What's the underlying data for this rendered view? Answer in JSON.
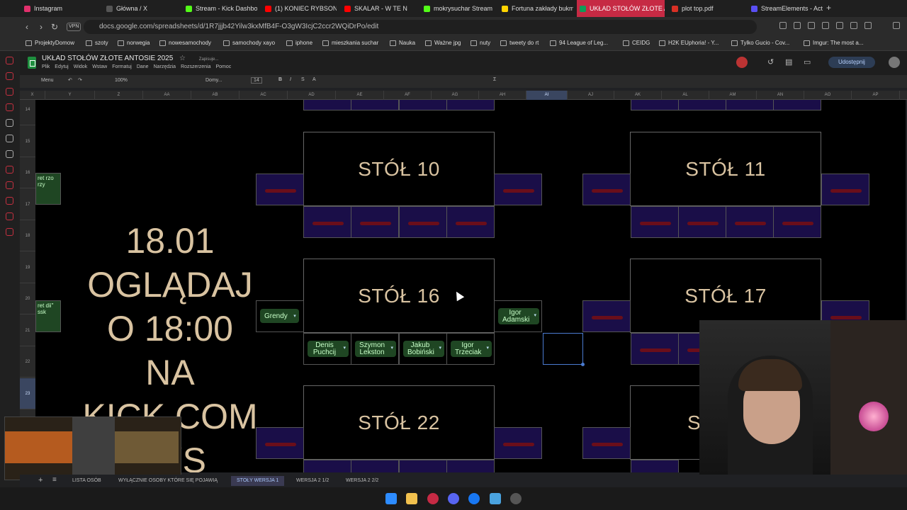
{
  "tabs": [
    {
      "label": "Instagram",
      "color": "#e1306c"
    },
    {
      "label": "Główna / X",
      "color": "#000000"
    },
    {
      "label": "Stream - Kick Dashbo",
      "color": "#53fc18"
    },
    {
      "label": "(1) KONIEC RYBSONA",
      "color": "#ff0000"
    },
    {
      "label": "SKALAR - W TE N",
      "color": "#ff0000"
    },
    {
      "label": "mokrysuchar Stream",
      "color": "#53fc18"
    },
    {
      "label": "Fortuna zakłady bukm",
      "color": "#ffd400"
    },
    {
      "label": "UKŁAD STOŁÓW ZŁOTE A",
      "color": "#0f9d58",
      "active": true
    },
    {
      "label": "plot top.pdf",
      "color": "#d93025"
    },
    {
      "label": "StreamElements - Acti",
      "color": "#5a4ff3"
    }
  ],
  "address": {
    "url": "docs.google.com/spreadsheets/d/1R7jjjb42Yilw3kxMfB4F-O3gW3IcjC2ccr2WQiDrPo/edit",
    "vpn": "VPN"
  },
  "bookmarks": [
    "ProjektyDomow",
    "szoty",
    "norwegia",
    "nowesamochody",
    "samochody xayo",
    "iphone",
    "mieszkania suchar",
    "Nauka",
    "Ważne jpg",
    "nuty",
    "tweety do rt",
    "94 League of Leg...",
    "CEIDG",
    "H2K EUphoria! - Y...",
    "Tylko Gucio - Cov...",
    "Imgur: The most a..."
  ],
  "sheet": {
    "title": "UKŁAD STOŁÓW ZŁOTE ANTOSIE 2025",
    "saving": "Zapisuje...",
    "menus": [
      "Plik",
      "Edytuj",
      "Widok",
      "Wstaw",
      "Formatuj",
      "Dane",
      "Narzędzia",
      "Rozszerzenia",
      "Pomoc"
    ],
    "share": "Udostępnij",
    "toolbar": {
      "menu": "Menu",
      "zoom": "100%",
      "font": "Domy...",
      "size": "14"
    },
    "columns": [
      "X",
      "Y",
      "Z",
      "AA",
      "AB",
      "AC",
      "AD",
      "AE",
      "AF",
      "AG",
      "AH",
      "AI",
      "AJ",
      "AK",
      "AL",
      "AM",
      "AN",
      "AO",
      "AP"
    ],
    "rows": [
      "14",
      "15",
      "16",
      "17",
      "18",
      "19",
      "20",
      "21",
      "22",
      "23",
      "24",
      "25"
    ]
  },
  "tables": {
    "t10": "STÓŁ 10",
    "t11": "STÓŁ 11",
    "t16": "STÓŁ 16",
    "t17": "STÓŁ 17",
    "t22": "STÓŁ 22",
    "t23": "S"
  },
  "bigtext": [
    "18.01",
    "OGLĄDAJ",
    "O 18:00",
    "NA",
    "KICK.COM",
    "RYS"
  ],
  "left_peek": {
    "a": "ret rzo rzy",
    "b": "ret dii\" ssk"
  },
  "people": {
    "grendy": "Grendy",
    "igor_a": "Igor Adamski",
    "denis": "Denis Puchcij",
    "szymon": "Szymon Lekston",
    "jakub": "Jakub Bobiński",
    "igor_t": "Igor Trzeciak"
  },
  "sheet_tabs": [
    "LISTA OSÓB",
    "WYŁĄCZNIE OSOBY KTÓRE SIĘ POJAWIĄ",
    "STOŁY WERSJA 1",
    "WERSJA 2 1/2",
    "WERSJA 2 2/2"
  ],
  "active_sheet": "STOŁY WERSJA 1"
}
